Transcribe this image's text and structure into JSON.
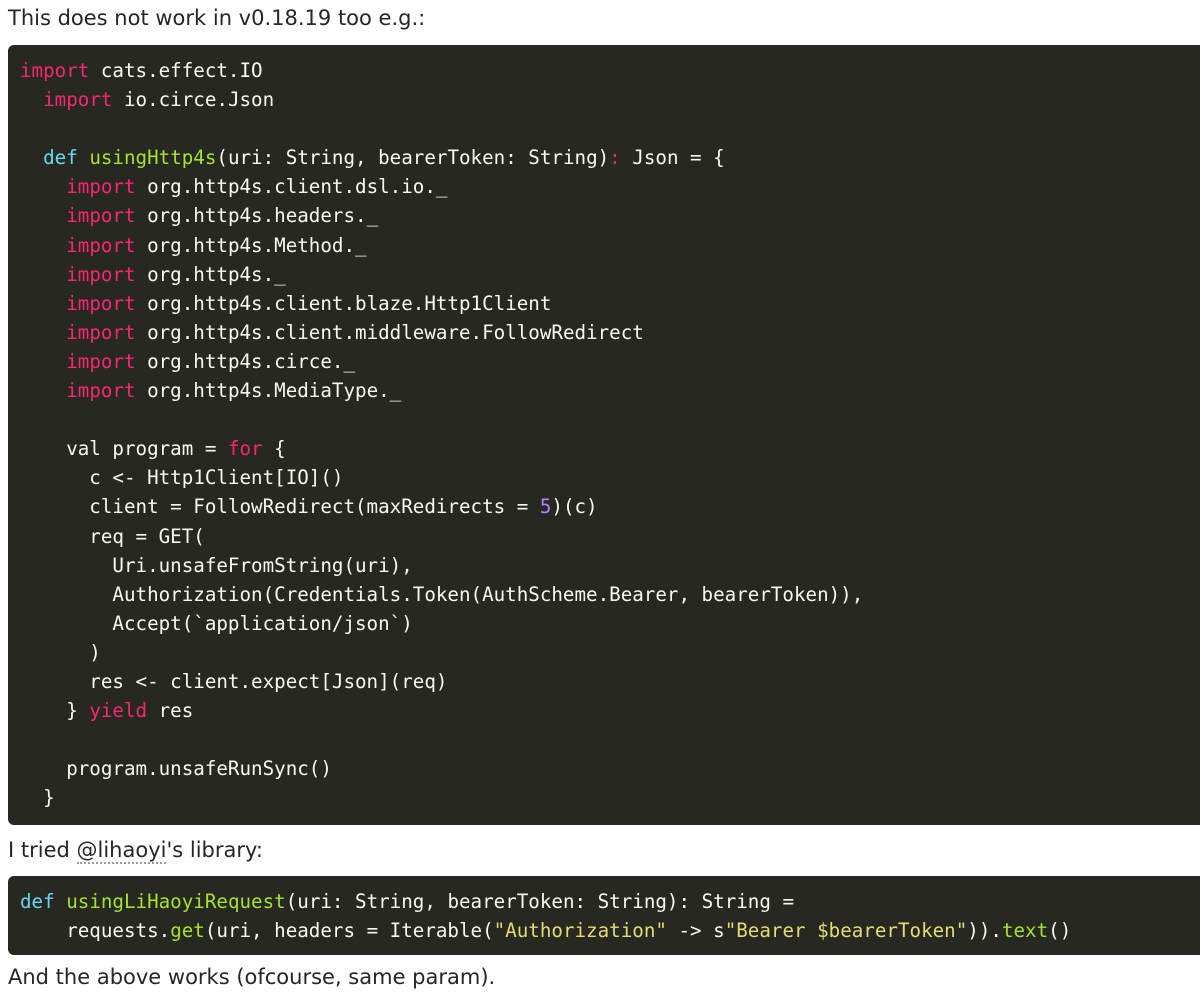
{
  "intro_text": "This does not work in v0.18.19 too e.g.:",
  "code_block_1": {
    "lines": [
      [
        {
          "t": "import",
          "c": "kw"
        },
        {
          "t": " cats.effect.IO"
        }
      ],
      [
        {
          "t": "  "
        },
        {
          "t": "import",
          "c": "kw"
        },
        {
          "t": " io.circe.Json"
        }
      ],
      [],
      [
        {
          "t": "  "
        },
        {
          "t": "def",
          "c": "df"
        },
        {
          "t": " "
        },
        {
          "t": "usingHttp4s",
          "c": "fn"
        },
        {
          "t": "(uri: String, bearerToken: String)"
        },
        {
          "t": ":",
          "c": "kw"
        },
        {
          "t": " Json = {"
        }
      ],
      [
        {
          "t": "    "
        },
        {
          "t": "import",
          "c": "kw"
        },
        {
          "t": " org.http4s.client.dsl.io._"
        }
      ],
      [
        {
          "t": "    "
        },
        {
          "t": "import",
          "c": "kw"
        },
        {
          "t": " org.http4s.headers._"
        }
      ],
      [
        {
          "t": "    "
        },
        {
          "t": "import",
          "c": "kw"
        },
        {
          "t": " org.http4s.Method._"
        }
      ],
      [
        {
          "t": "    "
        },
        {
          "t": "import",
          "c": "kw"
        },
        {
          "t": " org.http4s._"
        }
      ],
      [
        {
          "t": "    "
        },
        {
          "t": "import",
          "c": "kw"
        },
        {
          "t": " org.http4s.client.blaze.Http1Client"
        }
      ],
      [
        {
          "t": "    "
        },
        {
          "t": "import",
          "c": "kw"
        },
        {
          "t": " org.http4s.client.middleware.FollowRedirect"
        }
      ],
      [
        {
          "t": "    "
        },
        {
          "t": "import",
          "c": "kw"
        },
        {
          "t": " org.http4s.circe._"
        }
      ],
      [
        {
          "t": "    "
        },
        {
          "t": "import",
          "c": "kw"
        },
        {
          "t": " org.http4s.MediaType._"
        }
      ],
      [],
      [
        {
          "t": "    val program = "
        },
        {
          "t": "for",
          "c": "kw"
        },
        {
          "t": " {"
        }
      ],
      [
        {
          "t": "      c <- Http1Client[IO]()"
        }
      ],
      [
        {
          "t": "      client = FollowRedirect(maxRedirects = "
        },
        {
          "t": "5",
          "c": "nm"
        },
        {
          "t": ")(c)"
        }
      ],
      [
        {
          "t": "      req = GET("
        }
      ],
      [
        {
          "t": "        Uri.unsafeFromString(uri),"
        }
      ],
      [
        {
          "t": "        Authorization(Credentials.Token(AuthScheme.Bearer, bearerToken)),"
        }
      ],
      [
        {
          "t": "        Accept(`application/json`)"
        }
      ],
      [
        {
          "t": "      )"
        }
      ],
      [
        {
          "t": "      res <- client.expect[Json](req)"
        }
      ],
      [
        {
          "t": "    } "
        },
        {
          "t": "yield",
          "c": "kw"
        },
        {
          "t": " res"
        }
      ],
      [],
      [
        {
          "t": "    program.unsafeRunSync()"
        }
      ],
      [
        {
          "t": "  }"
        }
      ]
    ]
  },
  "middle_text": {
    "prefix": "I tried ",
    "mention": "@lihaoyi",
    "suffix": "'s library:"
  },
  "code_block_2": {
    "lines": [
      [
        {
          "t": "def",
          "c": "df"
        },
        {
          "t": " "
        },
        {
          "t": "usingLiHaoyiRequest",
          "c": "fn"
        },
        {
          "t": "(uri: String, bearerToken: String): String ="
        }
      ],
      [
        {
          "t": "    requests."
        },
        {
          "t": "get",
          "c": "fn"
        },
        {
          "t": "(uri, headers = Iterable("
        },
        {
          "t": "\"Authorization\"",
          "c": "st"
        },
        {
          "t": " -> s"
        },
        {
          "t": "\"Bearer $bearerToken\"",
          "c": "st"
        },
        {
          "t": "))."
        },
        {
          "t": "text",
          "c": "fn"
        },
        {
          "t": "()"
        }
      ]
    ]
  },
  "outro_text": "And the above works (ofcourse, same param).",
  "colors": {
    "code_background": "#272822",
    "code_text": "#f8f8f2",
    "keyword": "#f92672",
    "function_name": "#a6e22e",
    "def_keyword": "#66d9ef",
    "number": "#ae81ff",
    "string": "#e6db74"
  }
}
